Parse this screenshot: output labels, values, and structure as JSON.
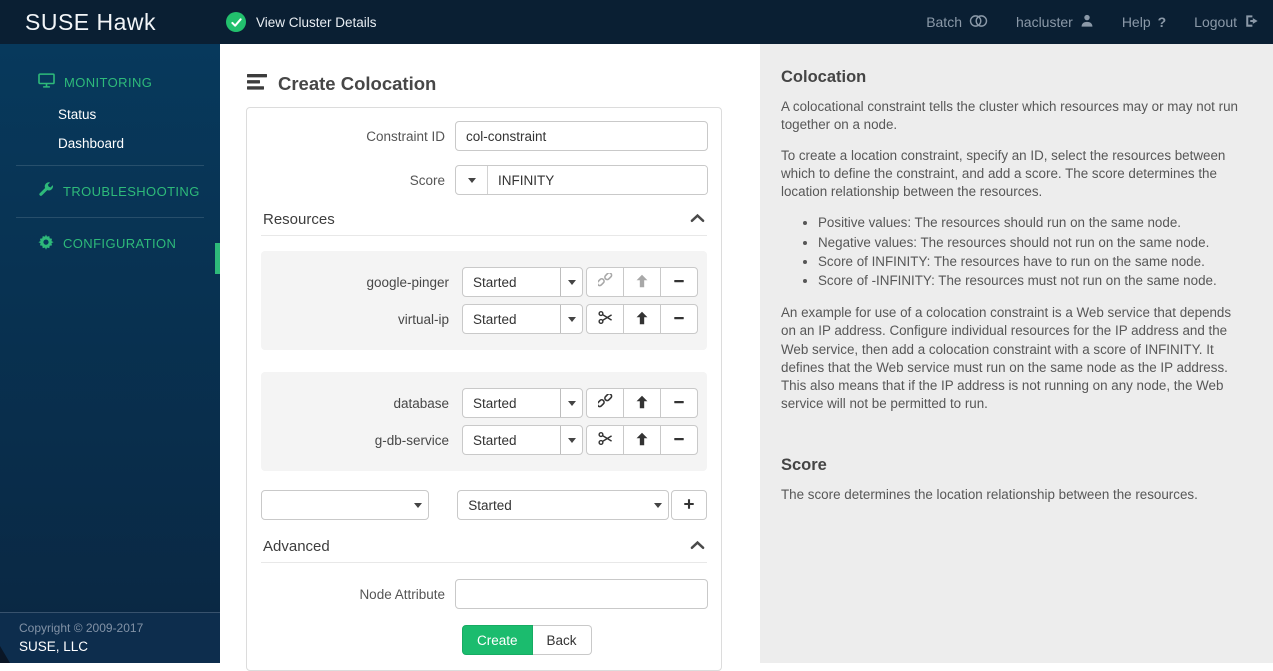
{
  "topbar": {
    "brand": "SUSE Hawk",
    "cluster_status_label": "View Cluster Details",
    "batch_label": "Batch",
    "user_label": "hacluster",
    "help_label": "Help",
    "help_icon": "?",
    "logout_label": "Logout"
  },
  "sidebar": {
    "monitoring_label": "MONITORING",
    "monitoring_items": [
      {
        "label": "Status"
      },
      {
        "label": "Dashboard"
      }
    ],
    "troubleshooting_label": "TROUBLESHOOTING",
    "configuration_label": "CONFIGURATION",
    "footer": {
      "copyright": "Copyright © 2009-2017",
      "company": "SUSE, LLC"
    }
  },
  "form": {
    "title": "Create Colocation",
    "constraint_id": {
      "label": "Constraint ID",
      "value": "col-constraint"
    },
    "score": {
      "label": "Score",
      "value": "INFINITY"
    },
    "resources_section_label": "Resources",
    "groups": [
      {
        "rows": [
          {
            "name": "google-pinger",
            "role": "Started"
          },
          {
            "name": "virtual-ip",
            "role": "Started"
          }
        ]
      },
      {
        "rows": [
          {
            "name": "database",
            "role": "Started"
          },
          {
            "name": "g-db-service",
            "role": "Started"
          }
        ]
      }
    ],
    "add_row": {
      "resource_value": "",
      "role_value": "Started"
    },
    "advanced_section_label": "Advanced",
    "node_attribute": {
      "label": "Node Attribute",
      "value": ""
    },
    "create_label": "Create",
    "back_label": "Back"
  },
  "help": {
    "colocation_title": "Colocation",
    "p1": "A colocational constraint tells the cluster which resources may or may not run together on a node.",
    "p2": "To create a location constraint, specify an ID, select the resources between which to define the constraint, and add a score. The score determines the location relationship between the resources.",
    "bullets": [
      "Positive values: The resources should run on the same node.",
      "Negative values: The resources should not run on the same node.",
      "Score of INFINITY: The resources have to run on the same node.",
      "Score of -INFINITY: The resources must not run on the same node."
    ],
    "p3": "An example for use of a colocation constraint is a Web service that depends on an IP address. Configure individual resources for the IP address and the Web service, then add a colocation constraint with a score of INFINITY. It defines that the Web service must run on the same node as the IP address. This also means that if the IP address is not running on any node, the Web service will not be permitted to run.",
    "score_title": "Score",
    "score_text": "The score determines the location relationship between the resources."
  },
  "colors": {
    "accent_green": "#2eba7a",
    "status_ok_green": "#22c06d",
    "create_button_green": "#1bbc6e",
    "topbar_bg": "#0a1f33",
    "sidebar_bg": "#07395c",
    "help_panel_bg": "#ededed"
  }
}
